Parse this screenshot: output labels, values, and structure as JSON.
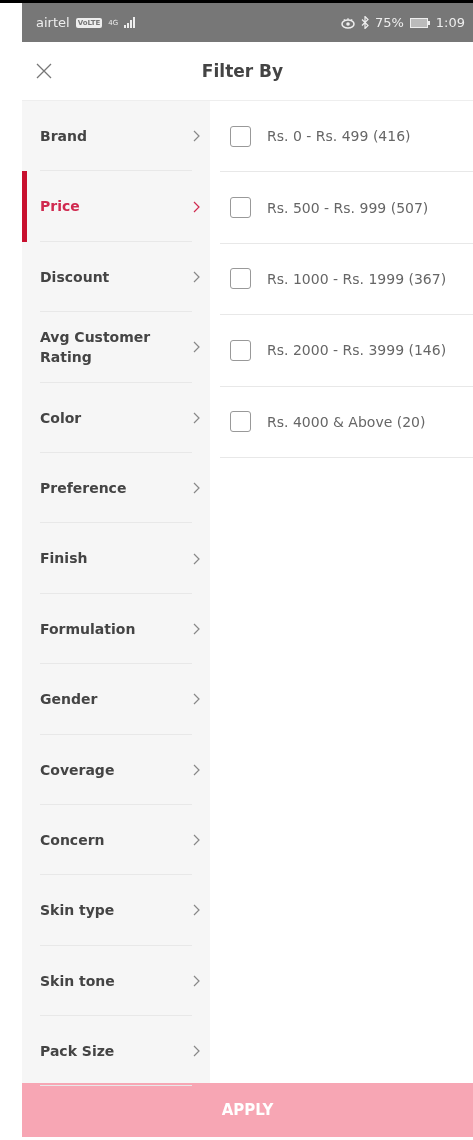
{
  "status_bar": {
    "carrier": "airtel",
    "volte": "VoLTE",
    "network": "4G",
    "battery": "75%",
    "time": "1:09"
  },
  "header": {
    "title": "Filter By"
  },
  "categories": [
    {
      "label": "Brand",
      "selected": false
    },
    {
      "label": "Price",
      "selected": true
    },
    {
      "label": "Discount",
      "selected": false
    },
    {
      "label": "Avg Customer Rating",
      "selected": false
    },
    {
      "label": "Color",
      "selected": false
    },
    {
      "label": "Preference",
      "selected": false
    },
    {
      "label": "Finish",
      "selected": false
    },
    {
      "label": "Formulation",
      "selected": false
    },
    {
      "label": "Gender",
      "selected": false
    },
    {
      "label": "Coverage",
      "selected": false
    },
    {
      "label": "Concern",
      "selected": false
    },
    {
      "label": "Skin type",
      "selected": false
    },
    {
      "label": "Skin tone",
      "selected": false
    },
    {
      "label": "Pack Size",
      "selected": false
    }
  ],
  "options": [
    {
      "label": "Rs. 0 - Rs. 499 (416)",
      "checked": false
    },
    {
      "label": "Rs. 500 - Rs. 999 (507)",
      "checked": false
    },
    {
      "label": "Rs. 1000 - Rs. 1999 (367)",
      "checked": false
    },
    {
      "label": "Rs. 2000 - Rs. 3999 (146)",
      "checked": false
    },
    {
      "label": "Rs. 4000 & Above (20)",
      "checked": false
    }
  ],
  "apply_button": {
    "label": "APPLY",
    "disabled": true
  }
}
